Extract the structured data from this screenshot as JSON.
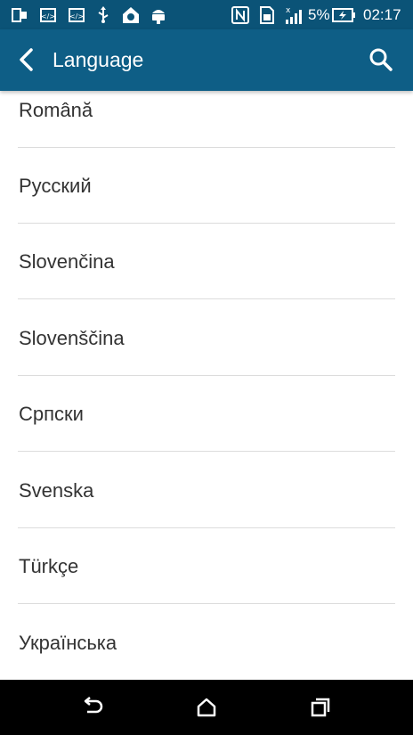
{
  "status_bar": {
    "battery_percent": "5%",
    "time": "02:17",
    "icons": [
      "phone-icon",
      "code-icon",
      "code-icon",
      "usb-icon",
      "home-location-icon",
      "android-icon",
      "nfc-icon",
      "sim-icon",
      "signal-icon",
      "battery-charging-icon"
    ]
  },
  "app_bar": {
    "title": "Language",
    "back_icon": "chevron-left-icon",
    "search_icon": "search-icon"
  },
  "languages": [
    "Română",
    "Русский",
    "Slovenčina",
    "Slovenščina",
    "Српски",
    "Svenska",
    "Türkçe",
    "Українська"
  ],
  "nav_bar": {
    "buttons": [
      "back-icon",
      "home-icon",
      "recents-icon"
    ]
  },
  "colors": {
    "status_bar": "#0b5377",
    "app_bar": "#0e5e86",
    "list_text": "#333333",
    "divider": "#dcdcdc",
    "nav_bar": "#000000"
  }
}
